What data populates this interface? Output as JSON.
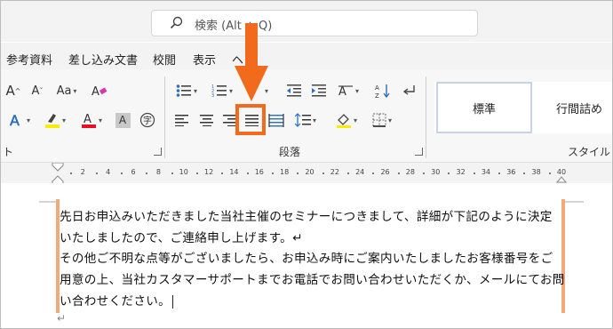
{
  "search": {
    "icon": "search-icon",
    "placeholder": "検索 (Alt + Q)"
  },
  "tabs": [
    "参考資料",
    "差し込み文書",
    "校閲",
    "表示",
    "ヘ"
  ],
  "ribbon": {
    "font": {
      "grow_label": "A",
      "shrink_label": "A",
      "case_label": "Aa",
      "a_label": "A"
    },
    "paragraph_group_label": "段落",
    "styles_group_label": "スタイル",
    "style_items": [
      "標準",
      "行間詰め"
    ],
    "left_group_label": "ト"
  },
  "ruler": {
    "numbers": [
      "2",
      "4",
      "6",
      "8",
      "10",
      "12",
      "14",
      "16",
      "18",
      "20",
      "22",
      "24",
      "26",
      "28",
      "30",
      "32",
      "34",
      "36",
      "38",
      "40"
    ]
  },
  "document": {
    "lines": [
      "先日お申込みいただきました当社主催のセミナーにつきまして、詳細が下記のように決定",
      "いたしましたので、ご連絡申し上げます。↵",
      "その他ご不明な点等がございましたら、お申込み時にご案内いたしましたお客様番号をご",
      "用意の上、当社カスタマーサポートまでお電話でお問い合わせいただくか、メールにてお問",
      "い合わせください。"
    ],
    "end_mark": "↵"
  },
  "colors": {
    "accent": "#f26b1d",
    "indent_bar": "#f4a97a",
    "highlight": "#ffeb00",
    "font_red": "#e81123"
  }
}
